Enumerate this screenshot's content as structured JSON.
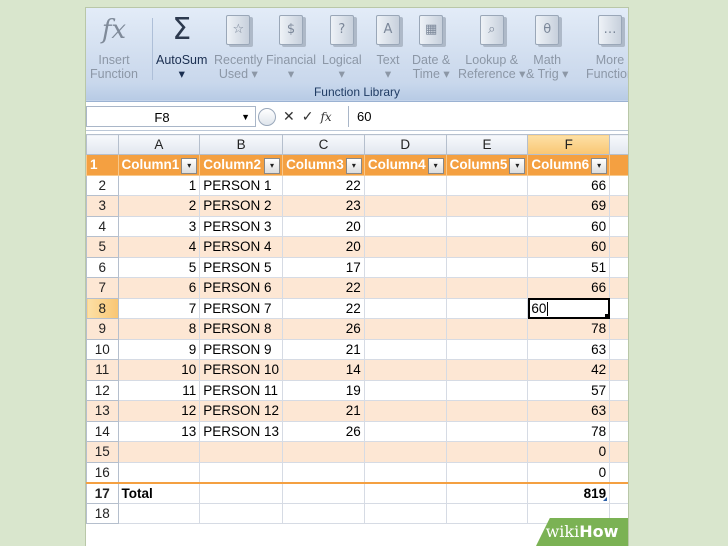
{
  "ribbon": {
    "buttons": [
      {
        "id": "insert-function",
        "label1": "Insert",
        "label2": "Function",
        "icon": "fx",
        "active": false
      },
      {
        "id": "autosum",
        "label1": "AutoSum",
        "label2": "▾",
        "icon": "Σ",
        "active": true
      },
      {
        "id": "recently-used",
        "label1": "Recently",
        "label2": "Used ▾",
        "icon": "☆",
        "active": false
      },
      {
        "id": "financial",
        "label1": "Financial",
        "label2": "▾",
        "icon": "$",
        "active": false
      },
      {
        "id": "logical",
        "label1": "Logical",
        "label2": "▾",
        "icon": "?",
        "active": false
      },
      {
        "id": "text",
        "label1": "Text",
        "label2": "▾",
        "icon": "A",
        "active": false
      },
      {
        "id": "date-time",
        "label1": "Date &",
        "label2": "Time ▾",
        "icon": "▦",
        "active": false
      },
      {
        "id": "lookup-reference",
        "label1": "Lookup &",
        "label2": "Reference ▾",
        "icon": "⌕",
        "active": false
      },
      {
        "id": "math-trig",
        "label1": "Math",
        "label2": "& Trig ▾",
        "icon": "θ",
        "active": false
      },
      {
        "id": "more-functions",
        "label1": "More",
        "label2": "Function",
        "icon": "…",
        "active": false
      }
    ],
    "group_label": "Function Library"
  },
  "formula_bar": {
    "name_box": "F8",
    "name_box_dropdown": "▼",
    "circle": "◯",
    "cancel": "✕",
    "confirm": "✓",
    "fx": "fx",
    "value": "60"
  },
  "sheet": {
    "columns": [
      "A",
      "B",
      "C",
      "D",
      "E",
      "F"
    ],
    "selected_column": "F",
    "header_row": {
      "row": "1",
      "cells": [
        "Column1",
        "Column2",
        "Column3",
        "Column4",
        "Column5",
        "Column6"
      ]
    },
    "rows": [
      {
        "row": "2",
        "a": "1",
        "b": "PERSON 1",
        "c": "22",
        "f": "66"
      },
      {
        "row": "3",
        "a": "2",
        "b": "PERSON 2",
        "c": "23",
        "f": "69"
      },
      {
        "row": "4",
        "a": "3",
        "b": "PERSON 3",
        "c": "20",
        "f": "60"
      },
      {
        "row": "5",
        "a": "4",
        "b": "PERSON 4",
        "c": "20",
        "f": "60"
      },
      {
        "row": "6",
        "a": "5",
        "b": "PERSON 5",
        "c": "17",
        "f": "51"
      },
      {
        "row": "7",
        "a": "6",
        "b": "PERSON 6",
        "c": "22",
        "f": "66"
      },
      {
        "row": "8",
        "a": "7",
        "b": "PERSON 7",
        "c": "22",
        "f": "60"
      },
      {
        "row": "9",
        "a": "8",
        "b": "PERSON 8",
        "c": "26",
        "f": "78"
      },
      {
        "row": "10",
        "a": "9",
        "b": "PERSON 9",
        "c": "21",
        "f": "63"
      },
      {
        "row": "11",
        "a": "10",
        "b": "PERSON 10",
        "c": "14",
        "f": "42"
      },
      {
        "row": "12",
        "a": "11",
        "b": "PERSON 11",
        "c": "19",
        "f": "57"
      },
      {
        "row": "13",
        "a": "12",
        "b": "PERSON 12",
        "c": "21",
        "f": "63"
      },
      {
        "row": "14",
        "a": "13",
        "b": "PERSON 13",
        "c": "26",
        "f": "78"
      },
      {
        "row": "15",
        "a": "",
        "b": "",
        "c": "",
        "f": "0"
      },
      {
        "row": "16",
        "a": "",
        "b": "",
        "c": "",
        "f": "0"
      }
    ],
    "total_row": {
      "row": "17",
      "label": "Total",
      "f": "819"
    },
    "partial_row": "18",
    "active_cell": {
      "row": "8",
      "column": "F"
    }
  },
  "watermark": {
    "prefix": "wiki",
    "suffix": "How"
  }
}
